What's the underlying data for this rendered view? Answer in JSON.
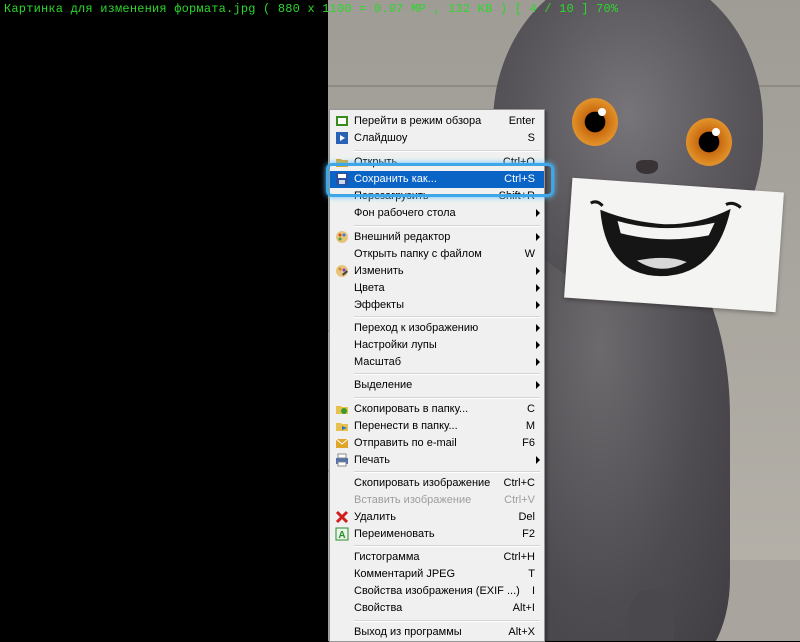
{
  "status_bar": {
    "text": "Картинка для изменения формата.jpg  ( 880 x 1100 = 0.97 MP  ,  132 KB )  [ 4 / 10 ]  70%"
  },
  "menu": {
    "items": [
      {
        "label": "Перейти в режим обзора",
        "shortcut": "Enter",
        "icon": "browse-icon",
        "color": "#3a8a1f"
      },
      {
        "label": "Слайдшоу",
        "shortcut": "S",
        "icon": "slideshow-icon",
        "color": "#2a62b8"
      },
      {
        "label": "Открыть",
        "shortcut": "Ctrl+O",
        "icon": "open-folder-icon",
        "color": "#d9a82a"
      },
      {
        "label": "Сохранить как...",
        "shortcut": "Ctrl+S",
        "icon": "save-icon",
        "color": "#2c4f9e"
      },
      {
        "label": "Перезагрузить",
        "shortcut": "Shift+R",
        "icon": "",
        "color": ""
      },
      {
        "label": "Фон рабочего стола",
        "shortcut": "",
        "icon": "",
        "color": ""
      },
      {
        "label": "Внешний редактор",
        "shortcut": "",
        "icon": "paint-palette-icon",
        "color": "#d24b2a"
      },
      {
        "label": "Открыть папку с файлом",
        "shortcut": "W",
        "icon": "",
        "color": ""
      },
      {
        "label": "Изменить",
        "shortcut": "",
        "icon": "edit-palette-icon",
        "color": "#d2882a"
      },
      {
        "label": "Цвета",
        "shortcut": "",
        "icon": "",
        "color": ""
      },
      {
        "label": "Эффекты",
        "shortcut": "",
        "icon": "",
        "color": ""
      },
      {
        "label": "Переход к изображению",
        "shortcut": "",
        "icon": "",
        "color": ""
      },
      {
        "label": "Настройки лупы",
        "shortcut": "",
        "icon": "",
        "color": ""
      },
      {
        "label": "Масштаб",
        "shortcut": "",
        "icon": "",
        "color": ""
      },
      {
        "label": "Выделение",
        "shortcut": "",
        "icon": "",
        "color": ""
      },
      {
        "label": "Скопировать в папку...",
        "shortcut": "C",
        "icon": "copy-to-folder-icon",
        "color": "#3a9a2f"
      },
      {
        "label": "Перенести в папку...",
        "shortcut": "M",
        "icon": "move-to-folder-icon",
        "color": "#2f74c4"
      },
      {
        "label": "Отправить по e-mail",
        "shortcut": "F6",
        "icon": "email-icon",
        "color": "#e0a52a"
      },
      {
        "label": "Печать",
        "shortcut": "",
        "icon": "printer-icon",
        "color": "#5470a8"
      },
      {
        "label": "Скопировать изображение",
        "shortcut": "Ctrl+C",
        "icon": "",
        "color": ""
      },
      {
        "label": "Вставить изображение",
        "shortcut": "Ctrl+V",
        "icon": "",
        "color": ""
      },
      {
        "label": "Удалить",
        "shortcut": "Del",
        "icon": "delete-icon",
        "color": "#d11d1d"
      },
      {
        "label": "Переименовать",
        "shortcut": "F2",
        "icon": "rename-icon",
        "color": "#2d8a2d"
      },
      {
        "label": "Гистограмма",
        "shortcut": "Ctrl+H",
        "icon": "",
        "color": ""
      },
      {
        "label": "Комментарий JPEG",
        "shortcut": "T",
        "icon": "",
        "color": ""
      },
      {
        "label": "Свойства изображения (EXIF ...)",
        "shortcut": "I",
        "icon": "",
        "color": ""
      },
      {
        "label": "Свойства",
        "shortcut": "Alt+I",
        "icon": "",
        "color": ""
      },
      {
        "label": "Выход из программы",
        "shortcut": "Alt+X",
        "icon": "",
        "color": ""
      }
    ]
  },
  "colors": {
    "status_text": "#2bd82b",
    "highlight": "#0a64c6",
    "focus_ring": "#3ea7e8"
  }
}
